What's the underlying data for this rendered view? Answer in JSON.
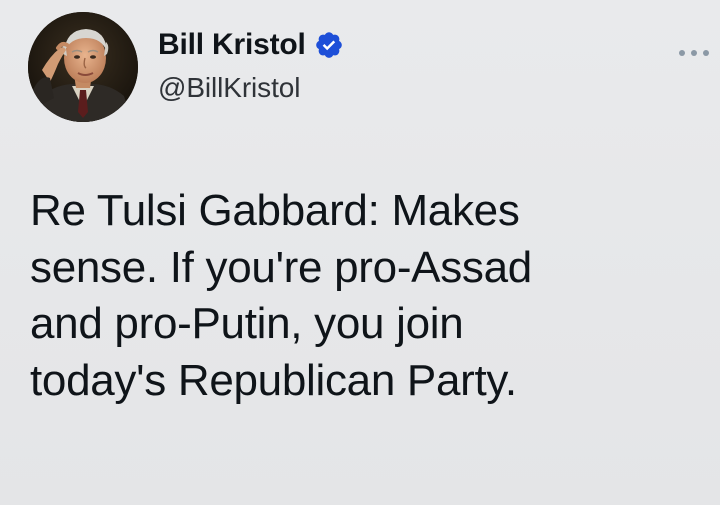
{
  "tweet": {
    "author": {
      "display_name": "Bill Kristol",
      "handle": "@BillKristol",
      "verified": true,
      "avatar_icon": "profile-photo"
    },
    "more_icon": "more-horizontal-icon",
    "text": "Re Tulsi Gabbard: Makes\nsense. If you're pro-Assad\nand pro-Putin, you join\ntoday's Republican Party."
  },
  "colors": {
    "background": "#e6e7e9",
    "text": "#0f1419",
    "handle": "#2f3338",
    "verified": "#1d4fd8",
    "more": "#8b99a6"
  }
}
